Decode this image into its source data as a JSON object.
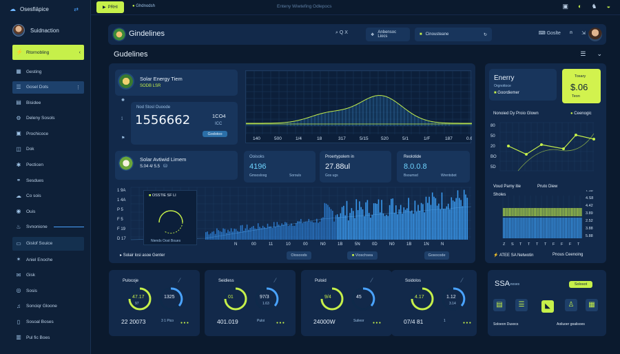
{
  "sidebar": {
    "brand": "Osesfiäpice",
    "user": "Suidnaction",
    "items": [
      {
        "icon": "bolt",
        "label": "Rtornobling"
      },
      {
        "icon": "grid",
        "label": "Gesting"
      },
      {
        "icon": "menu",
        "label": "Gosel Dots"
      },
      {
        "icon": "chart",
        "label": "Bisidee"
      },
      {
        "icon": "gear",
        "label": "Deleny Sosols"
      },
      {
        "icon": "doc",
        "label": "Prochicoce"
      },
      {
        "icon": "box",
        "label": "Dok"
      },
      {
        "icon": "star",
        "label": "Pecticen"
      },
      {
        "icon": "link",
        "label": "Sesdues"
      },
      {
        "icon": "cloud",
        "label": "Co sois"
      },
      {
        "icon": "user",
        "label": "Ouis"
      },
      {
        "icon": "fire",
        "label": "Svnonione"
      },
      {
        "icon": "folder",
        "label": "Gislof Souice"
      },
      {
        "icon": "spark",
        "label": "Aniel Enoche"
      },
      {
        "icon": "mail",
        "label": "Gisk"
      },
      {
        "icon": "target",
        "label": "Sosis"
      },
      {
        "icon": "bell",
        "label": "Sonciqr Gloone"
      },
      {
        "icon": "page",
        "label": "Sosoal Boses"
      },
      {
        "icon": "list",
        "label": "Pul fic Boes"
      }
    ]
  },
  "topbar": {
    "pill": "PRHI",
    "sub": "Ghdnodsh",
    "center": "Enteny Wiwtefing Odlepocs"
  },
  "header": {
    "title": "Gindelines",
    "search": "Q",
    "search_x": "X",
    "btn1": "Anbensoc Liocs",
    "btn2": "Cinousteane",
    "btn3": "Goslte"
  },
  "section_title": "Gudelines",
  "solar1": {
    "title": "Solar Energy Tiem",
    "sub": "SODB LSR",
    "label": "Nod Stosl Ouoode",
    "value": "1556662",
    "side": "1CO4",
    "side2": "ICC",
    "badge": "Godotoo"
  },
  "line_chart": {
    "ticks": [
      "140",
      "500",
      "1/4",
      "18",
      "317",
      "5/15",
      "520",
      "5/1",
      "1/F",
      "187",
      "0.63"
    ]
  },
  "solar2": {
    "title": "Solar Avtiwid Limem",
    "sub": "S.04 4/ 5.5"
  },
  "stats": [
    {
      "label": "Ooisoks",
      "value": "4196",
      "sub": "Gmsosloog",
      "sub2": "Sorouls"
    },
    {
      "label": "Proertypolem in",
      "value": "27.88ul",
      "sub": "Gos ugs"
    },
    {
      "label": "Reolotide",
      "value": "8.0.0.8",
      "sub": "Bsoumsd",
      "sub2": "Wrentsbot"
    }
  ],
  "histogram": {
    "yticks": [
      "1 9A",
      "1 4A",
      "P 5",
      "F 5",
      "F 19",
      "D 17"
    ],
    "xticks": [
      "N",
      "00",
      "11",
      "10",
      "00",
      "N0",
      "1B",
      "5N",
      "0D",
      "N0",
      "1B",
      "1N",
      "N"
    ],
    "inset_title": "OSSTIE SF LI",
    "inset_sub": "Niends Oost Boues"
  },
  "bottom_bar": {
    "label": "Solair losi asoe Genter",
    "btn1": "Oiosoods",
    "btn2": "Vioschsea",
    "btn3": "Gosocode"
  },
  "energy": {
    "title": "Enerry",
    "sub": "Orgnottoce",
    "sub2": "Goordiemer",
    "badge_label": "Tosary",
    "badge_value": "$.06",
    "badge_sub": "Teon"
  },
  "right_chart": {
    "title": "Nonoied Dy Proio Glown",
    "legend": "Ceenogic",
    "yticks": [
      "80",
      "50",
      "20",
      "BO",
      "5D"
    ]
  },
  "right_hist": {
    "l1": "Voud Pamy itie",
    "l2": "Pruto Diew",
    "l3": "Sholes",
    "yticks": [
      "7.18",
      "4.S8",
      "4.42",
      "3.89",
      "2.52",
      "3.88",
      "5.88"
    ],
    "xticks": [
      "Z",
      "S",
      "T",
      "T",
      "T",
      "T",
      "F",
      "F",
      "F",
      "T"
    ],
    "footer_left": "ATEE SA Netwotin",
    "footer_right": "Pnous Ceenoing"
  },
  "kpis": [
    {
      "title": "Pulocoje",
      "gauge1": "47.17",
      "gauge1_sub": "97",
      "gauge2": "1325",
      "value": "22 20073",
      "sub": "3 1 Pico"
    },
    {
      "title": "Seidiess",
      "gauge1": "01",
      "gauge2": "97/3",
      "gauge2_sub": "1.63",
      "value": "401.019",
      "sub": "Puloi"
    },
    {
      "title": "Puloid",
      "gauge1": "9/4",
      "gauge2": "45",
      "value": "24000W",
      "sub": "Sulieor"
    },
    {
      "title": "Soidolos",
      "gauge1": "4.17",
      "gauge2": "1.12",
      "gauge2_sub": "3.14",
      "value": "07/4 81",
      "sub": "1"
    }
  ],
  "final": {
    "title": "SSA",
    "sub": "Lnoses",
    "badge": "Solosot",
    "l1": "Soloeon Dusocs",
    "l2": "Aoiluoer goalisoes"
  }
}
